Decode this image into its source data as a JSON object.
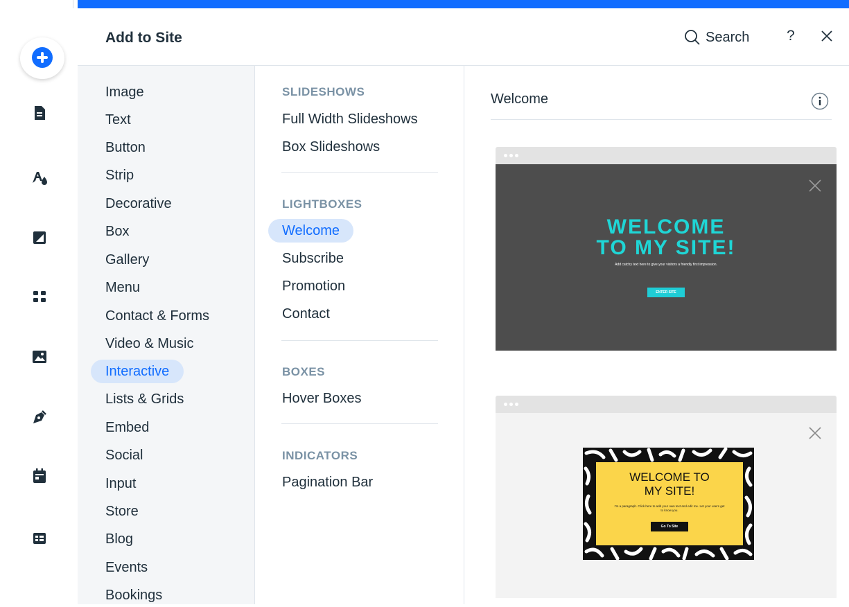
{
  "panel": {
    "title": "Add to Site",
    "search_label": "Search",
    "help_label": "?"
  },
  "rail": {
    "icons": [
      "add-elements-icon",
      "pages-icon",
      "site-design-icon",
      "background-icon",
      "app-market-icon",
      "media-icon",
      "blog-pen-icon",
      "bookings-calendar-icon",
      "my-business-icon"
    ]
  },
  "categories": [
    "Image",
    "Text",
    "Button",
    "Strip",
    "Decorative",
    "Box",
    "Gallery",
    "Menu",
    "Contact & Forms",
    "Video & Music",
    "Interactive",
    "Lists & Grids",
    "Embed",
    "Social",
    "Input",
    "Store",
    "Blog",
    "Events",
    "Bookings"
  ],
  "active_category": "Interactive",
  "sections": [
    {
      "heading": "SLIDESHOWS",
      "items": [
        "Full Width Slideshows",
        "Box Slideshows"
      ]
    },
    {
      "heading": "LIGHTBOXES",
      "items": [
        "Welcome",
        "Subscribe",
        "Promotion",
        "Contact"
      ]
    },
    {
      "heading": "BOXES",
      "items": [
        "Hover Boxes"
      ]
    },
    {
      "heading": "INDICATORS",
      "items": [
        "Pagination Bar"
      ]
    }
  ],
  "active_subitem": "Welcome",
  "preview": {
    "title": "Welcome",
    "card1": {
      "headline_line1": "WELCOME",
      "headline_line2": "TO MY SITE!",
      "paragraph": "Add catchy text here to give your visitors a friendly first impression.",
      "button": "ENTER SITE"
    },
    "card2": {
      "headline_line1": "WELCOME TO",
      "headline_line2": "MY SITE!",
      "paragraph": "I'm a paragraph. Click here to add your own text and edit me. Let your users get to know you.",
      "button": "Go To Site"
    }
  },
  "colors": {
    "accent": "#116dff",
    "selected_bg": "#d7e6fb",
    "teal": "#1fd6d6",
    "yellow": "#fbd54a"
  }
}
